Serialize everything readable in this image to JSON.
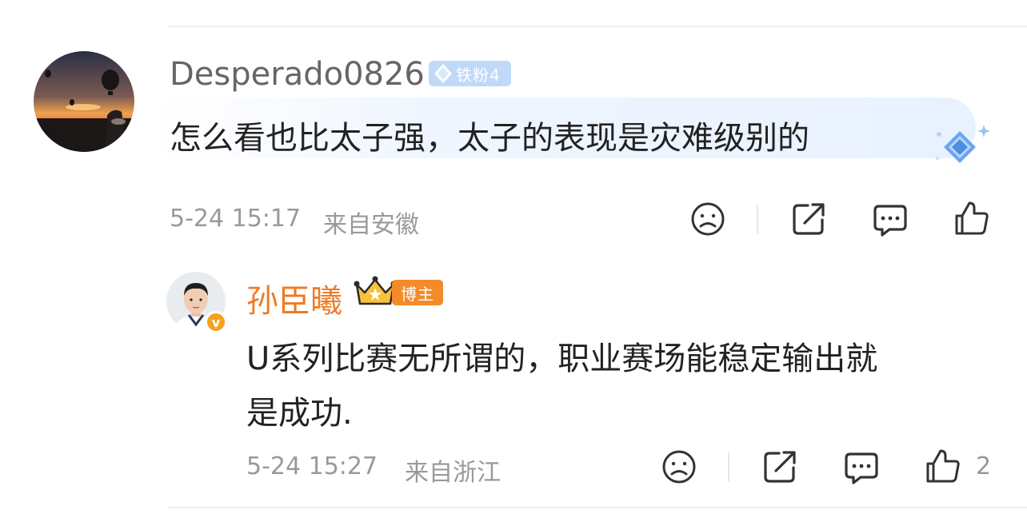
{
  "comment": {
    "username": "Desperado0826",
    "fan_badge": "铁粉4",
    "text": "怎么看也比太子强，太子的表现是灾难级别的",
    "timestamp": "5-24 15:17",
    "location": "来自安徽",
    "actions": [
      "dislike-icon",
      "share-icon",
      "reply-icon",
      "like-icon"
    ]
  },
  "reply": {
    "username": "孙臣曦",
    "blogger_badge": "博主",
    "verified_badge": "v",
    "text_line1": "U系列比赛无所谓的，职业赛场能稳定输出就",
    "text_line2": "是成功.",
    "timestamp": "5-24 15:27",
    "location": "来自浙江",
    "like_count": "2",
    "actions": [
      "dislike-icon",
      "share-icon",
      "reply-icon",
      "like-icon"
    ]
  },
  "colors": {
    "username_gray": "#666666",
    "username_orange": "#f07a24",
    "meta_gray": "#999999",
    "fan_badge_blue": "#bfd9f7",
    "blogger_badge_orange": "#f38b2a"
  }
}
